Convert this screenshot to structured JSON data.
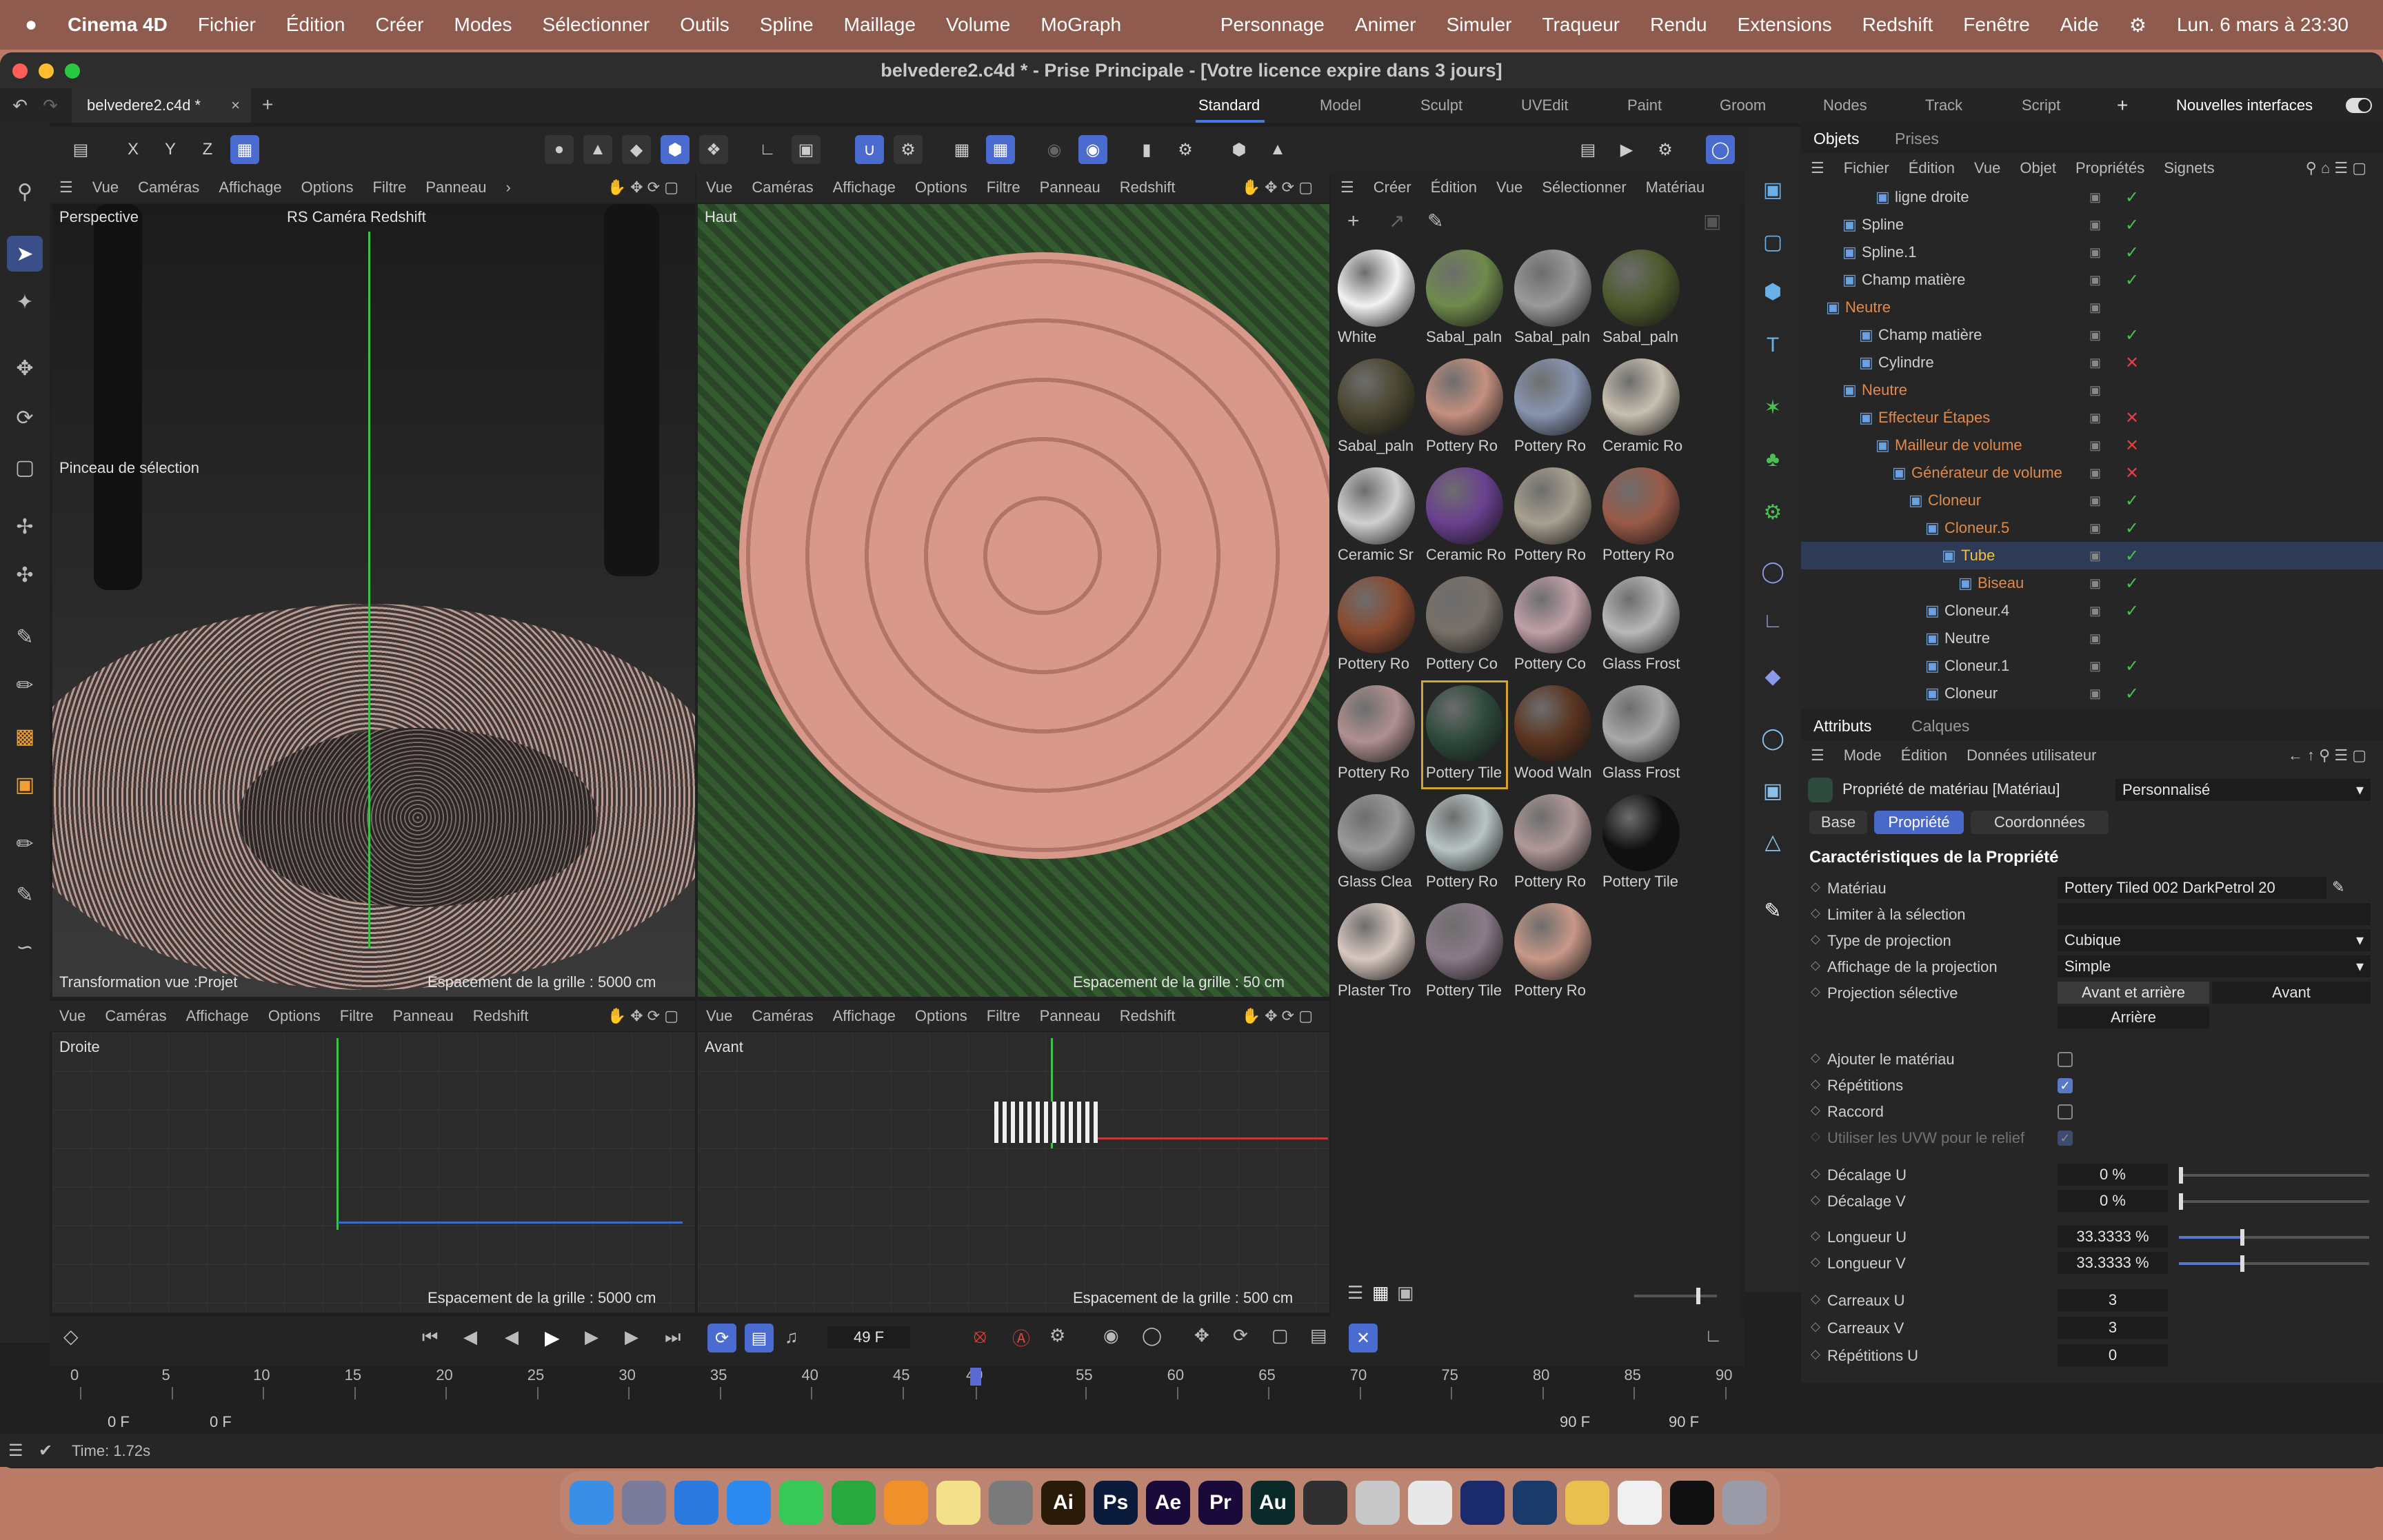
{
  "menubar": {
    "apple": "",
    "app": "Cinema 4D",
    "items": [
      "Fichier",
      "Édition",
      "Créer",
      "Modes",
      "Sélectionner",
      "Outils",
      "Spline",
      "Maillage",
      "Volume",
      "MoGraph"
    ],
    "right_items": [
      "Personnage",
      "Animer",
      "Simuler",
      "Traqueur",
      "Rendu",
      "Extensions",
      "Redshift",
      "Fenêtre",
      "Aide"
    ],
    "datetime": "Lun. 6 mars à 23:30"
  },
  "window": {
    "title": "belvedere2.c4d * - Prise Principale - [Votre licence expire dans 3 jours]",
    "doc_tab": "belvedere2.c4d *",
    "doc_tab_close": "×",
    "add_tab": "+"
  },
  "layouts": {
    "items": [
      "Standard",
      "Model",
      "Sculpt",
      "UVEdit",
      "Paint",
      "Groom",
      "Nodes",
      "Track",
      "Script"
    ],
    "add": "+",
    "new_interfaces": "Nouvelles interfaces"
  },
  "axis_buttons": [
    "X",
    "Y",
    "Z"
  ],
  "vp_menu": {
    "vue": "Vue",
    "cameras": "Caméras",
    "affichage": "Affichage",
    "options": "Options",
    "filtre": "Filtre",
    "panneau": "Panneau",
    "redshift": "Redshift",
    "more": "›"
  },
  "viewports": {
    "persp": {
      "name": "Perspective",
      "camera": "RS Caméra Redshift",
      "tool": "Pinceau de sélection",
      "footer": "Transformation vue :Projet",
      "grid": "Espacement de la grille : 5000 cm"
    },
    "top": {
      "name": "Haut",
      "grid": "Espacement de la grille : 50 cm"
    },
    "right": {
      "name": "Droite",
      "grid": "Espacement de la grille : 5000 cm"
    },
    "front": {
      "name": "Avant",
      "grid": "Espacement de la grille : 500 cm"
    }
  },
  "materials": {
    "menu": [
      "Créer",
      "Édition",
      "Vue",
      "Sélectionner",
      "Matériau"
    ],
    "items": [
      {
        "name": "White",
        "color": "#f2f2f2"
      },
      {
        "name": "Sabal_paln",
        "color": "#6f8a4c"
      },
      {
        "name": "Sabal_paln",
        "color": "#9a9a9a"
      },
      {
        "name": "Sabal_paln",
        "color": "#4d5a2c"
      },
      {
        "name": "Sabal_paln",
        "color": "#4a4630"
      },
      {
        "name": "Pottery Ro",
        "color": "#c49080"
      },
      {
        "name": "Pottery Ro",
        "color": "#8895b0"
      },
      {
        "name": "Ceramic Ro",
        "color": "#c8c0b0"
      },
      {
        "name": "Ceramic Sr",
        "color": "#d0d0d0"
      },
      {
        "name": "Ceramic Ro",
        "color": "#6a4090"
      },
      {
        "name": "Pottery Ro",
        "color": "#a8a090"
      },
      {
        "name": "Pottery Ro",
        "color": "#9a5a48"
      },
      {
        "name": "Pottery Ro",
        "color": "#8a4a30"
      },
      {
        "name": "Pottery Co",
        "color": "#787068"
      },
      {
        "name": "Pottery Co",
        "color": "#c0a0a8"
      },
      {
        "name": "Glass Frost",
        "color": "#b8b8b8"
      },
      {
        "name": "Pottery Ro",
        "color": "#b09090"
      },
      {
        "name": "Pottery Tile",
        "color": "#2e4a3c"
      },
      {
        "name": "Wood Waln",
        "color": "#5a3420"
      },
      {
        "name": "Glass Frost",
        "color": "#a8a8a8"
      },
      {
        "name": "Glass Clea",
        "color": "#9a9a9a"
      },
      {
        "name": "Pottery Ro",
        "color": "#b8c4c4"
      },
      {
        "name": "Pottery Ro",
        "color": "#b09898"
      },
      {
        "name": "Pottery Tile",
        "color": "#101010"
      },
      {
        "name": "Plaster Tro",
        "color": "#d8c8c0"
      },
      {
        "name": "Pottery Tile",
        "color": "#8a7a88"
      },
      {
        "name": "Pottery Ro",
        "color": "#c89888"
      }
    ]
  },
  "objects": {
    "tabs": [
      "Objets",
      "Prises"
    ],
    "menu": [
      "Fichier",
      "Édition",
      "Vue",
      "Objet",
      "Propriétés",
      "Signets"
    ],
    "rows": [
      {
        "name": "ligne droite",
        "indent": 3,
        "color": "#cfcfcf",
        "status": "check"
      },
      {
        "name": "Spline",
        "indent": 1,
        "color": "#cfcfcf",
        "status": "check"
      },
      {
        "name": "Spline.1",
        "indent": 1,
        "color": "#cfcfcf",
        "status": "check"
      },
      {
        "name": "Champ matière",
        "indent": 1,
        "color": "#cfcfcf",
        "status": "check"
      },
      {
        "name": "Neutre",
        "indent": 0,
        "color": "#e08a4a",
        "status": "none"
      },
      {
        "name": "Champ matière",
        "indent": 2,
        "color": "#cfcfcf",
        "status": "check"
      },
      {
        "name": "Cylindre",
        "indent": 2,
        "color": "#cfcfcf",
        "status": "x"
      },
      {
        "name": "Neutre",
        "indent": 1,
        "color": "#e08a4a",
        "status": "none"
      },
      {
        "name": "Effecteur Étapes",
        "indent": 2,
        "color": "#e08a4a",
        "status": "x"
      },
      {
        "name": "Mailleur de volume",
        "indent": 3,
        "color": "#e08a4a",
        "status": "x"
      },
      {
        "name": "Générateur de volume",
        "indent": 4,
        "color": "#e08a4a",
        "status": "x"
      },
      {
        "name": "Cloneur",
        "indent": 5,
        "color": "#e08a4a",
        "status": "check"
      },
      {
        "name": "Cloneur.5",
        "indent": 6,
        "color": "#e08a4a",
        "status": "check"
      },
      {
        "name": "Tube",
        "indent": 7,
        "color": "#f0c040",
        "status": "check"
      },
      {
        "name": "Biseau",
        "indent": 8,
        "color": "#e08a4a",
        "status": "check"
      },
      {
        "name": "Cloneur.4",
        "indent": 6,
        "color": "#cfcfcf",
        "status": "check"
      },
      {
        "name": "Neutre",
        "indent": 6,
        "color": "#cfcfcf",
        "status": "none"
      },
      {
        "name": "Cloneur.1",
        "indent": 6,
        "color": "#cfcfcf",
        "status": "check"
      },
      {
        "name": "Cloneur",
        "indent": 6,
        "color": "#cfcfcf",
        "status": "check"
      }
    ]
  },
  "attributes": {
    "tabs": [
      "Attributs",
      "Calques"
    ],
    "menu": [
      "Mode",
      "Édition",
      "Données utilisateur"
    ],
    "object_title": "Propriété de matériau [Matériau]",
    "preset": "Personnalisé",
    "subtabs": [
      "Base",
      "Propriété",
      "Coordonnées"
    ],
    "section": "Caractéristiques de la Propriété",
    "material_label": "Matériau",
    "material_value": "Pottery Tiled 002 DarkPetrol 20",
    "limit_label": "Limiter à la sélection",
    "proj_type_label": "Type de projection",
    "proj_type_value": "Cubique",
    "proj_disp_label": "Affichage de la projection",
    "proj_disp_value": "Simple",
    "proj_sel_label": "Projection sélective",
    "proj_opts": [
      "Avant et arrière",
      "Avant",
      "Arrière"
    ],
    "add_mat_label": "Ajouter le matériau",
    "rep_label": "Répétitions",
    "raccord_label": "Raccord",
    "uvw_label": "Utiliser les UVW pour le relief",
    "offset_u_label": "Décalage U",
    "offset_u": "0 %",
    "offset_v_label": "Décalage V",
    "offset_v": "0 %",
    "len_u_label": "Longueur U",
    "len_u": "33.3333 %",
    "len_v_label": "Longueur V",
    "len_v": "33.3333 %",
    "len_u_fraction": 0.333,
    "len_v_fraction": 0.333,
    "tiles_u_label": "Carreaux U",
    "tiles_u": "3",
    "tiles_v_label": "Carreaux V",
    "tiles_v": "3",
    "reps_u_label": "Répétitions U",
    "reps_u": "0",
    "reps_v_label": "Répétitions V",
    "reps_v": "0"
  },
  "timeline": {
    "current_frame": "49 F",
    "start": "0 F",
    "start2": "0 F",
    "end": "90 F",
    "end2": "90 F",
    "ticks": [
      "0",
      "5",
      "10",
      "15",
      "20",
      "25",
      "30",
      "35",
      "40",
      "45",
      "49",
      "55",
      "60",
      "65",
      "70",
      "75",
      "80",
      "85",
      "90"
    ],
    "playhead_frame": 49
  },
  "status": {
    "time": "Time: 1.72s"
  },
  "dock": {
    "apps": [
      {
        "name": "Finder",
        "label": "",
        "color": "#3a8ee6"
      },
      {
        "name": "Launchpad",
        "label": "",
        "color": "#7a7a9a"
      },
      {
        "name": "Safari",
        "label": "",
        "color": "#2a7ae0"
      },
      {
        "name": "App Store",
        "label": "",
        "color": "#2a8af0"
      },
      {
        "name": "Messages",
        "label": "",
        "color": "#38c858"
      },
      {
        "name": "Numbers",
        "label": "",
        "color": "#2aa840"
      },
      {
        "name": "Pages",
        "label": "",
        "color": "#f0902a"
      },
      {
        "name": "Notes",
        "label": "",
        "color": "#f2e08a"
      },
      {
        "name": "Settings",
        "label": "",
        "color": "#7a7a7a"
      },
      {
        "name": "Illustrator",
        "label": "Ai",
        "color": "#2a1a08"
      },
      {
        "name": "Photoshop",
        "label": "Ps",
        "color": "#0a1a3a"
      },
      {
        "name": "After Effects",
        "label": "Ae",
        "color": "#1a0a3a"
      },
      {
        "name": "Premiere",
        "label": "Pr",
        "color": "#1a0a3a"
      },
      {
        "name": "Audition",
        "label": "Au",
        "color": "#0a2a2a"
      },
      {
        "name": "Blender",
        "label": "",
        "color": "#303030"
      },
      {
        "name": "Preview",
        "label": "",
        "color": "#c8c8c8"
      },
      {
        "name": "Unity",
        "label": "",
        "color": "#e8e8e8"
      },
      {
        "name": "Cinema 4D",
        "label": "",
        "color": "#1a2a6a"
      },
      {
        "name": "Steam",
        "label": "",
        "color": "#1a3a6a"
      },
      {
        "name": "Archive",
        "label": "",
        "color": "#e8c050"
      },
      {
        "name": "Document",
        "label": "",
        "color": "#f0f0f0"
      },
      {
        "name": "Terminal",
        "label": "",
        "color": "#101010"
      },
      {
        "name": "Trash",
        "label": "",
        "color": "#9a9aa8"
      }
    ]
  }
}
